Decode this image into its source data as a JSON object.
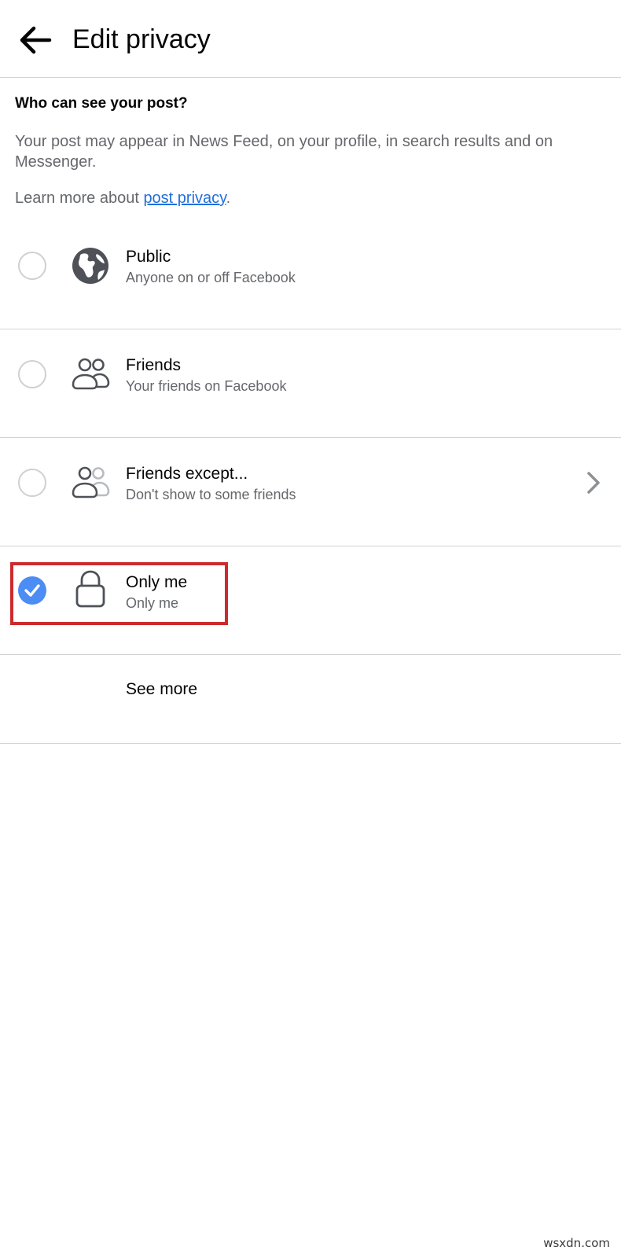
{
  "header": {
    "title": "Edit privacy",
    "back_icon": "arrow-left-icon"
  },
  "intro": {
    "question": "Who can see your post?",
    "description": "Your post may appear in News Feed, on your profile, in search results and on Messenger.",
    "learn_more_prefix": "Learn more about ",
    "learn_more_link": "post privacy",
    "learn_more_suffix": "."
  },
  "options": [
    {
      "title": "Public",
      "subtitle": "Anyone on or off Facebook",
      "icon": "globe-icon",
      "selected": false
    },
    {
      "title": "Friends",
      "subtitle": "Your friends on Facebook",
      "icon": "friends-icon",
      "selected": false
    },
    {
      "title": "Friends except...",
      "subtitle": "Don't show to some friends",
      "icon": "friends-except-icon",
      "selected": false,
      "has_chevron": true
    },
    {
      "title": "Only me",
      "subtitle": "Only me",
      "icon": "lock-icon",
      "selected": true
    }
  ],
  "see_more": {
    "label": "See more"
  },
  "colors": {
    "accent": "#4b8cf5",
    "link": "#216fdb",
    "highlight": "#cc2a2e",
    "secondary_text": "#65676b",
    "divider": "#d2d3d6"
  },
  "watermark": "wsxdn.com"
}
